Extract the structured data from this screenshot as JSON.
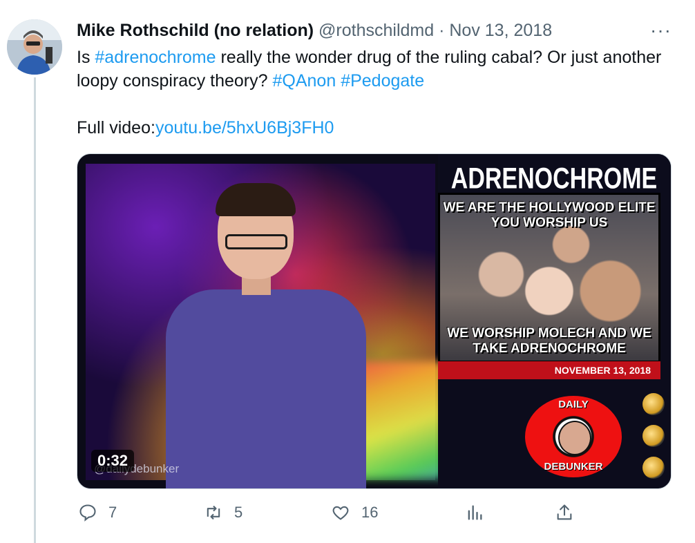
{
  "tweet": {
    "author_name": "Mike Rothschild (no relation)",
    "handle": "@rothschildmd",
    "separator": "·",
    "date": "Nov 13, 2018",
    "more": "···",
    "text": {
      "p1": "Is ",
      "tag1": "#adrenochrome",
      "p2": " really the wonder drug of the ruling cabal? Or just another loopy conspiracy theory? ",
      "tag2": "#QAnon",
      "p3": " ",
      "tag3": "#Pedogate",
      "full_label": "Full video:",
      "url": "youtu.be/5hxU6Bj3FH0"
    }
  },
  "media": {
    "duration": "0:32",
    "watermark": "@dailydebunker",
    "side_title": "ADRENOCHROME",
    "poster_top": "WE ARE THE HOLLYWOOD ELITE YOU WORSHIP US",
    "poster_bottom": "WE WORSHIP MOLECH AND WE TAKE ADRENOCHROME",
    "date_strip": "NOVEMBER 13, 2018",
    "logo_top": "DAILY",
    "logo_bottom": "DEBUNKER"
  },
  "actions": {
    "replies": "7",
    "retweets": "5",
    "likes": "16",
    "views": "",
    "share": ""
  },
  "colors": {
    "link": "#1d9bf0",
    "muted": "#536471",
    "text": "#0f1419"
  }
}
